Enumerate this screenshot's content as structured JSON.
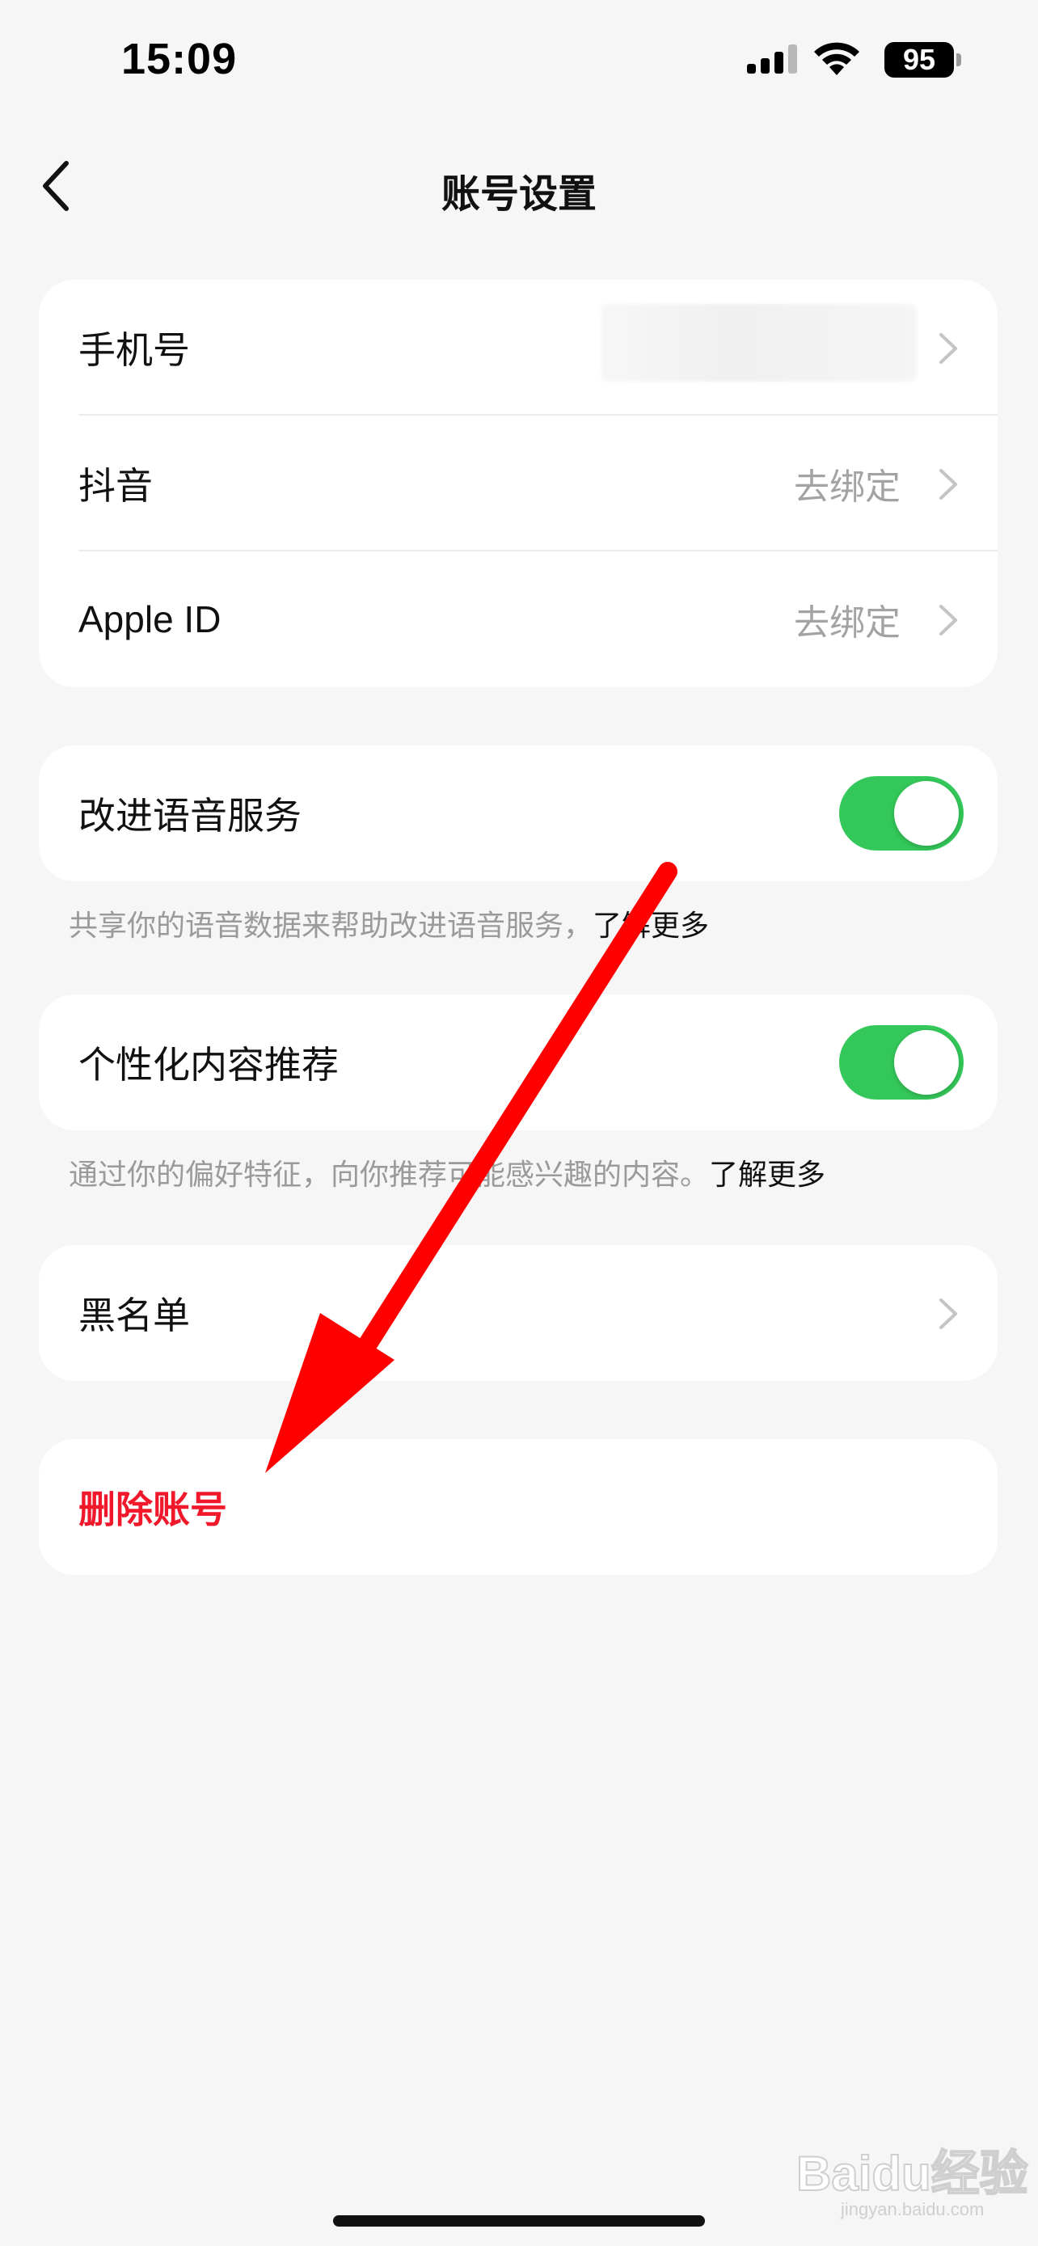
{
  "status_bar": {
    "time": "15:09",
    "battery": "95"
  },
  "nav": {
    "title": "账号设置",
    "back_icon": "chevron-left-icon"
  },
  "bindings": [
    {
      "label": "手机号",
      "value": "",
      "icon": "chevron-right-icon"
    },
    {
      "label": "抖音",
      "value": "去绑定",
      "icon": "chevron-right-icon"
    },
    {
      "label": "Apple ID",
      "value": "去绑定",
      "icon": "chevron-right-icon"
    }
  ],
  "voice_service": {
    "label": "改进语音服务",
    "enabled": true,
    "note": "共享你的语音数据来帮助改进语音服务，",
    "link": "了解更多"
  },
  "personalized": {
    "label": "个性化内容推荐",
    "enabled": true,
    "note": "通过你的偏好特征，向你推荐可能感兴趣的内容。",
    "link": "了解更多"
  },
  "blacklist": {
    "label": "黑名单"
  },
  "delete_account": {
    "label": "删除账号"
  },
  "colors": {
    "background": "#f6f6f6",
    "toggle_on": "#34c759",
    "danger": "#f0182a",
    "annotation_arrow": "#ff0000"
  },
  "watermark": {
    "text": "Baidu经验",
    "sub": "jingyan.baidu.com"
  }
}
